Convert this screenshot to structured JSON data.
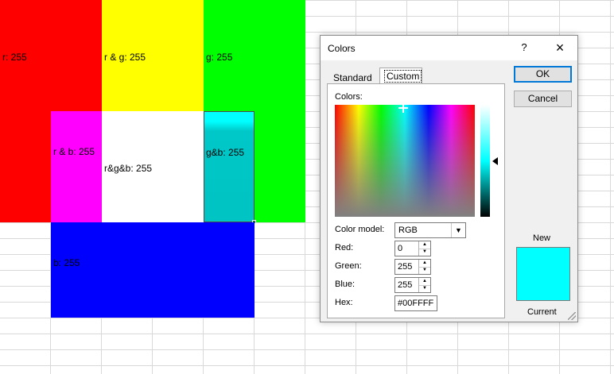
{
  "sheet": {
    "cells": [
      {
        "name": "cell-red",
        "label": "r: 255",
        "color": "#ff0000"
      },
      {
        "name": "cell-yellow",
        "label": "r & g: 255",
        "color": "#ffff00"
      },
      {
        "name": "cell-green",
        "label": "g: 255",
        "color": "#00ff00"
      },
      {
        "name": "cell-magenta",
        "label": "r & b: 255",
        "color": "#ff00ff"
      },
      {
        "name": "cell-white",
        "label": "r&g&b: 255",
        "color": "#ffffff"
      },
      {
        "name": "cell-cyan",
        "label": "g&b: 255",
        "color": "#00c3c3"
      },
      {
        "name": "cell-blue",
        "label": "b: 255",
        "color": "#0000ff"
      }
    ]
  },
  "dialog": {
    "title": "Colors",
    "help_icon": "?",
    "close_icon": "×",
    "tabs": {
      "standard": "Standard",
      "custom": "Custom"
    },
    "colors_label": "Colors:",
    "color_model_label": "Color model:",
    "color_model_value": "RGB",
    "red_label": "Red:",
    "red_value": "0",
    "green_label": "Green:",
    "green_value": "255",
    "blue_label": "Blue:",
    "blue_value": "255",
    "hex_label": "Hex:",
    "hex_value": "#00FFFF",
    "ok_label": "OK",
    "cancel_label": "Cancel",
    "new_label": "New",
    "current_label": "Current",
    "preview_color": "#00ffff"
  }
}
